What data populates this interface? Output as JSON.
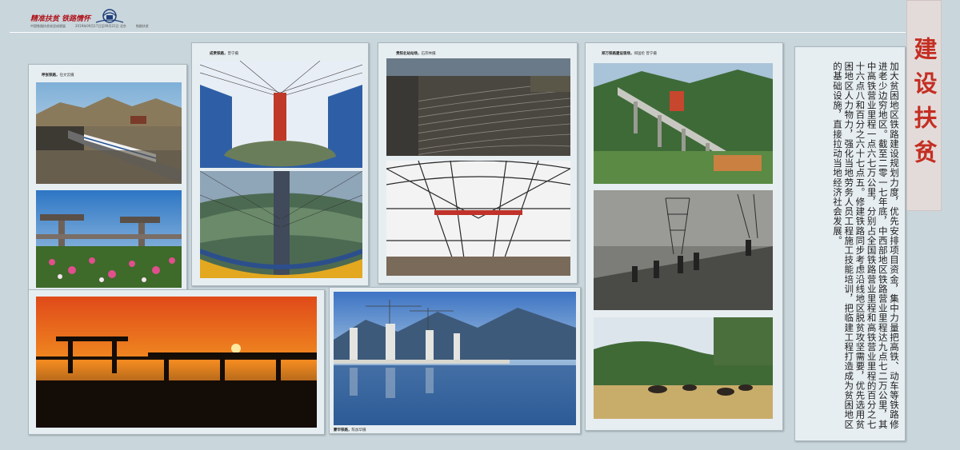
{
  "header": {
    "brand_text": "精准扶贫 铁路情怀",
    "sub_left": "中国铁路扶贫攻坚成就展",
    "sub_mid": "2019年09月17日至09月21日 北京",
    "sub_right": "铁路扶贫"
  },
  "title": "建设扶贫",
  "body_text": "加大贫困地区铁路建设规划力度，优先安排项目资金，集中力量把高铁、动车等铁路修进老少边穷地区。截至二零一七年底，中西部地区铁路营业里程达九点七二万公里，其中高铁营业里程一点六七万公里，分别占全国铁路营业里程和高铁营业里程的百分之七十六点八和百分之六十七点五。修建铁路同步考虑沿线地区脱贫攻坚需要，优先选用贫困地区人力物力，强化当地劳务人员工程施工技能培训，把临建工程打造成为贫困地区的基础设施，直接拉动当地经济社会发展。",
  "captions": {
    "p1": {
      "title": "呼张铁路，",
      "credit": "任文云摄"
    },
    "p2": {
      "title": "成贵铁路，",
      "credit": "曾宁摄"
    },
    "p3": {
      "title": "贵阳北站站场，",
      "credit": "石宗林摄"
    },
    "p4": {
      "title": "郑万铁路建设现场，",
      "credit": "郑国伦 曾宁摄"
    },
    "p5": {
      "title": "蒙华铁路，",
      "credit": "陈加华摄"
    }
  },
  "colors": {
    "accent": "#c42e22",
    "panel": "#e7eef1",
    "background": "#c9d6dc"
  }
}
